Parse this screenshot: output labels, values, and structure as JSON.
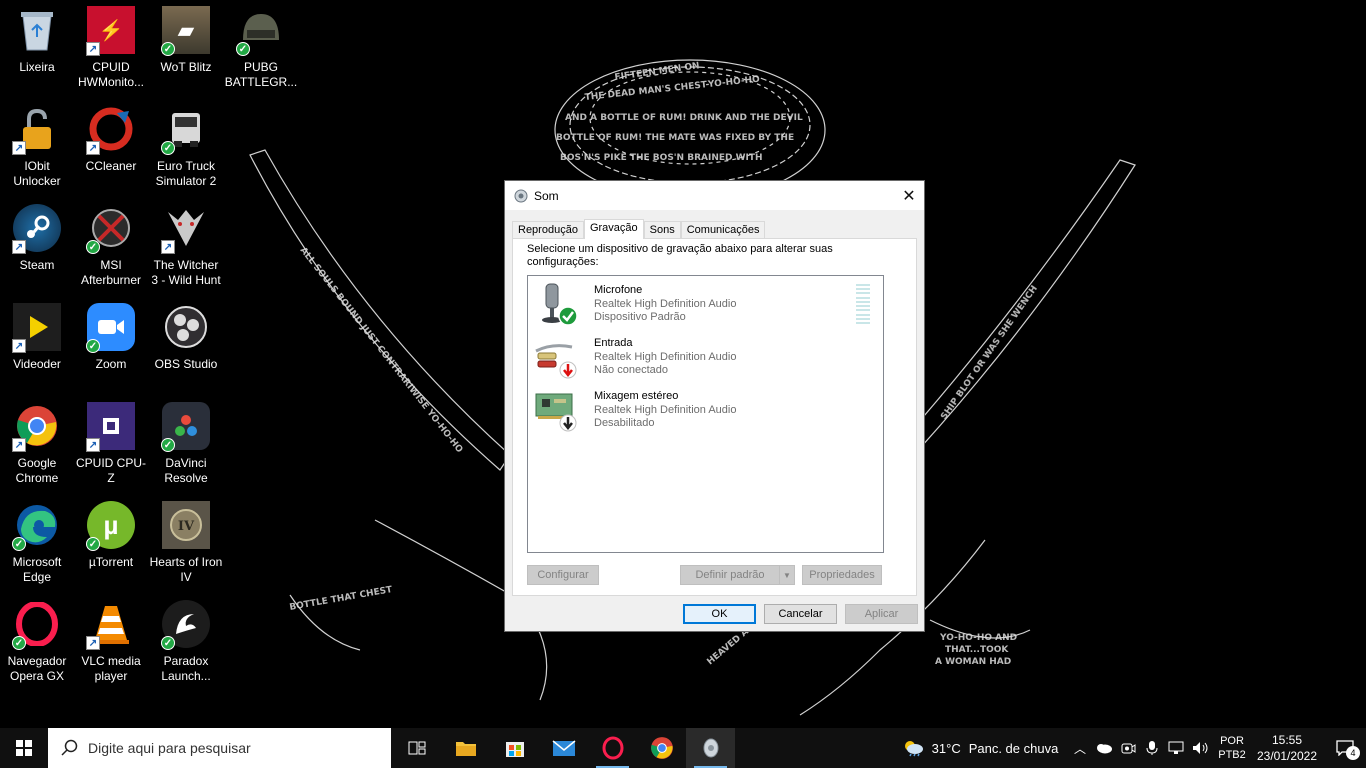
{
  "desktop": {
    "icons": [
      {
        "label": "Lixeira"
      },
      {
        "label": "CPUID HWMonito..."
      },
      {
        "label": "WoT Blitz"
      },
      {
        "label": "PUBG BATTLEGR..."
      },
      {
        "label": "IObit Unlocker"
      },
      {
        "label": "CCleaner"
      },
      {
        "label": "Euro Truck Simulator 2"
      },
      {
        "label": "Steam"
      },
      {
        "label": "MSI Afterburner"
      },
      {
        "label": "The Witcher 3 - Wild Hunt"
      },
      {
        "label": "Videoder"
      },
      {
        "label": "Zoom"
      },
      {
        "label": "OBS Studio"
      },
      {
        "label": "Google Chrome"
      },
      {
        "label": "CPUID CPU-Z"
      },
      {
        "label": "DaVinci Resolve"
      },
      {
        "label": "Microsoft Edge"
      },
      {
        "label": "µTorrent"
      },
      {
        "label": "Hearts of Iron IV"
      },
      {
        "label": "Navegador Opera GX"
      },
      {
        "label": "VLC media player"
      },
      {
        "label": "Paradox Launch..."
      }
    ]
  },
  "dialog": {
    "title": "Som",
    "tabs": [
      {
        "label": "Reprodução"
      },
      {
        "label": "Gravação"
      },
      {
        "label": "Sons"
      },
      {
        "label": "Comunicações"
      }
    ],
    "instruction": "Selecione um dispositivo de gravação abaixo para alterar suas configurações:",
    "devices": [
      {
        "name": "Microfone",
        "driver": "Realtek High Definition Audio",
        "status": "Dispositivo Padrão"
      },
      {
        "name": "Entrada",
        "driver": "Realtek High Definition Audio",
        "status": "Não conectado"
      },
      {
        "name": "Mixagem estéreo",
        "driver": "Realtek High Definition Audio",
        "status": "Desabilitado"
      }
    ],
    "buttons": {
      "configure": "Configurar",
      "set_default": "Definir padrão",
      "properties": "Propriedades",
      "ok": "OK",
      "cancel": "Cancelar",
      "apply": "Aplicar"
    }
  },
  "taskbar": {
    "search_placeholder": "Digite aqui para pesquisar",
    "weather_temp": "31°C",
    "weather_text": "Panc. de chuva",
    "lang_line1": "POR",
    "lang_line2": "PTB2",
    "time": "15:55",
    "date": "23/01/2022",
    "notification_count": "4"
  },
  "colors": {
    "accent": "#0078d7",
    "ok_green": "#22a845"
  }
}
